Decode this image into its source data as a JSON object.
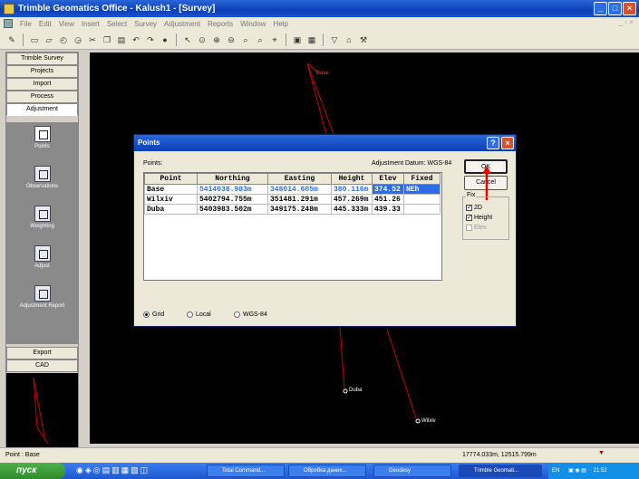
{
  "app": {
    "title": "Trimble Geomatics Office - Kalush1 - [Survey]"
  },
  "menu": [
    "File",
    "Edit",
    "View",
    "Insert",
    "Select",
    "Survey",
    "Adjustment",
    "Reports",
    "Window",
    "Help"
  ],
  "sidebar": {
    "top_buttons": [
      "Trimble Survey",
      "Projects",
      "Import",
      "Process",
      "Adjustment"
    ],
    "items": [
      "Points",
      "Observations",
      "Weighting",
      "Adjust",
      "Adjustment Report"
    ],
    "bottom_buttons": [
      "Export",
      "CAD"
    ]
  },
  "canvas": {
    "points": [
      "Base",
      "Duba",
      "Wilxiv"
    ]
  },
  "dialog": {
    "title": "Points",
    "label": "Points:",
    "datum": "Adjustment Datum: WGS-84",
    "columns": [
      "Point",
      "Northing",
      "Easting",
      "Height",
      "Elev",
      "Fixed"
    ],
    "rows": [
      [
        "Base",
        "5414038.983m",
        "348014.605m",
        "380.116m",
        "374.52",
        "NEh"
      ],
      [
        "Wilxiv",
        "5402794.755m",
        "351481.291m",
        "457.269m",
        "451.26",
        ""
      ],
      [
        "Duba",
        "5403983.502m",
        "349175.248m",
        "445.333m",
        "439.33",
        ""
      ]
    ],
    "ok": "OK",
    "cancel": "Cancel",
    "fix_title": "Fix",
    "fix": [
      {
        "label": "2D",
        "checked": true
      },
      {
        "label": "Height",
        "checked": true
      },
      {
        "label": "Elev",
        "checked": false
      }
    ],
    "radios": [
      {
        "label": "Grid",
        "on": true
      },
      {
        "label": "Local",
        "on": false
      },
      {
        "label": "WGS-84",
        "on": false
      }
    ]
  },
  "status": {
    "left": "Point : Base",
    "coords": "17774.033m, 12515.799m"
  },
  "taskbar": {
    "start": "пуск",
    "tasks": [
      "Total Command...",
      "Обробка даних...",
      "Geodesy",
      "Trimble Geomati..."
    ],
    "tray": "EN",
    "time": "21:52"
  }
}
